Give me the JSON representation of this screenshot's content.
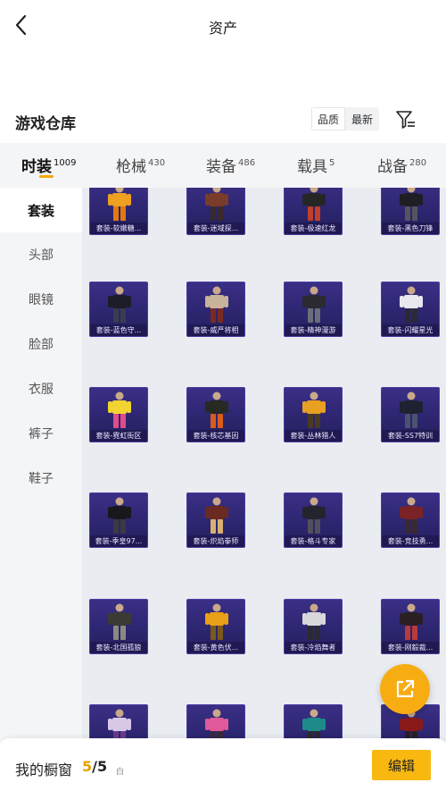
{
  "header": {
    "title": "资产",
    "back_icon": "chevron-left-icon"
  },
  "warehouse": {
    "title": "游戏仓库",
    "sort_options": [
      "品质",
      "最新"
    ],
    "filter_icon": "filter-icon"
  },
  "tabs": [
    {
      "label": "时装",
      "count": "1009"
    },
    {
      "label": "枪械",
      "count": "430"
    },
    {
      "label": "装备",
      "count": "486"
    },
    {
      "label": "载具",
      "count": "5"
    },
    {
      "label": "战备",
      "count": "280"
    }
  ],
  "sidebar": [
    "套装",
    "头部",
    "眼镜",
    "脸部",
    "衣服",
    "裤子",
    "鞋子"
  ],
  "items": [
    {
      "label": "套装-软嫩糖...",
      "colors": [
        "#f0a020",
        "#e07a10"
      ]
    },
    {
      "label": "套装-迷域探...",
      "colors": [
        "#7a3c2a",
        "#3a2a2a"
      ]
    },
    {
      "label": "套装-极速红龙",
      "colors": [
        "#262626",
        "#c0402a"
      ]
    },
    {
      "label": "套装-黑色刀锋",
      "colors": [
        "#1e1e24",
        "#55555e"
      ]
    },
    {
      "label": "套装-蓝色守...",
      "colors": [
        "#1c1d26",
        "#3a3d4c"
      ]
    },
    {
      "label": "套装-威严将相",
      "colors": [
        "#c8b29a",
        "#7a2a22"
      ]
    },
    {
      "label": "套装-精神漫游",
      "colors": [
        "#2a2a30",
        "#6a6e78"
      ]
    },
    {
      "label": "套装-闪耀星光",
      "colors": [
        "#e8e8ee",
        "#2a2a36"
      ]
    },
    {
      "label": "套装-霓虹街区",
      "colors": [
        "#f2d430",
        "#e04c8a"
      ]
    },
    {
      "label": "套装-核芯基因",
      "colors": [
        "#262a22",
        "#d85c1c"
      ]
    },
    {
      "label": "套装-丛林猎人",
      "colors": [
        "#e8a020",
        "#4a3a22"
      ]
    },
    {
      "label": "套装-SS7特训",
      "colors": [
        "#1e2230",
        "#4a5270"
      ]
    },
    {
      "label": "套装-季皇97...",
      "colors": [
        "#18181c",
        "#3a3a40"
      ]
    },
    {
      "label": "套装-炽焰拳师",
      "colors": [
        "#6a2a22",
        "#d8b070"
      ]
    },
    {
      "label": "套装-格斗专家",
      "colors": [
        "#24242c",
        "#50505c"
      ]
    },
    {
      "label": "套装-竞技勇...",
      "colors": [
        "#7a2226",
        "#3a2a30"
      ]
    },
    {
      "label": "套装-北国孤狼",
      "colors": [
        "#3c3a34",
        "#8a8a80"
      ]
    },
    {
      "label": "套装-黄色伏...",
      "colors": [
        "#e8a018",
        "#7a5a1a"
      ]
    },
    {
      "label": "套装-冷焰舞者",
      "colors": [
        "#d8d8dc",
        "#2a2a30"
      ]
    },
    {
      "label": "套装-刚毅裁...",
      "colors": [
        "#2a2024",
        "#b83a3a"
      ]
    },
    {
      "label": "",
      "colors": [
        "#d8c8e8",
        "#6a3a8a"
      ]
    },
    {
      "label": "",
      "colors": [
        "#e05a9a",
        "#3a2a3a"
      ]
    },
    {
      "label": "",
      "colors": [
        "#1e8a8a",
        "#2a2a30"
      ]
    },
    {
      "label": "",
      "colors": [
        "#8a1a1a",
        "#2a2024"
      ]
    }
  ],
  "share_icon": "share-external-icon",
  "bottom": {
    "showcase_label": "我的橱窗",
    "current": "5",
    "separator": "/",
    "total": "5",
    "mini_mark": "白",
    "edit_label": "编辑"
  },
  "colors": {
    "accent": "#f6a800",
    "card_bg": "#2d2670",
    "edit_bg": "#f9b80f"
  }
}
